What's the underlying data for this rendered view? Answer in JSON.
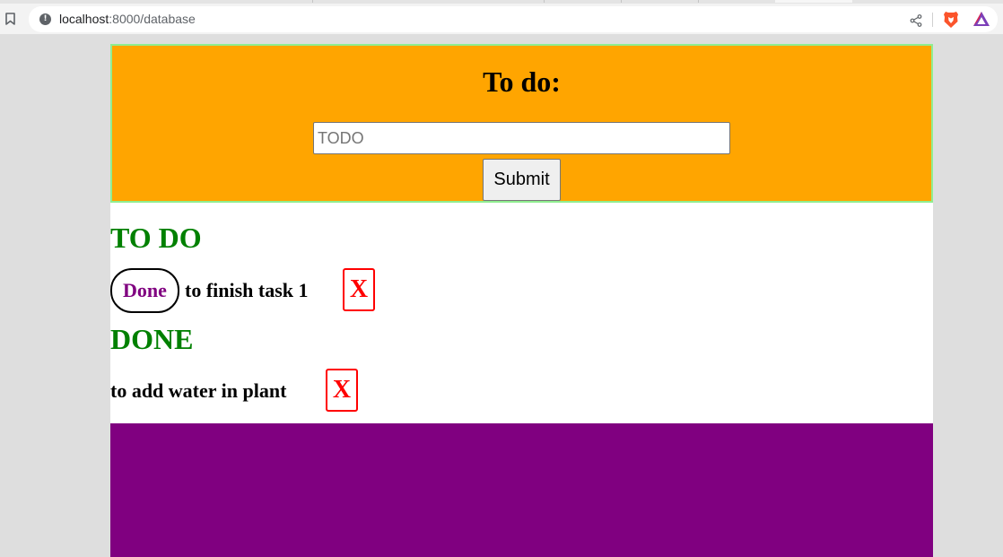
{
  "browser": {
    "url_host": "localhost",
    "url_path": ":8000/database",
    "icons": {
      "bookmark": "bookmark-icon",
      "site_info": "info-icon",
      "share": "share-icon",
      "brave": "brave-shields-icon",
      "rewards": "brave-rewards-icon"
    }
  },
  "form": {
    "title": "To do:",
    "input_placeholder": "TODO",
    "input_value": "",
    "submit_label": "Submit"
  },
  "todo": {
    "heading": "TO DO",
    "items": [
      {
        "done_label": "Done",
        "text": "to finish task 1",
        "delete_label": "X"
      }
    ]
  },
  "done": {
    "heading": "DONE",
    "items": [
      {
        "text": "to add water in plant",
        "delete_label": "X"
      }
    ]
  },
  "colors": {
    "form_background": "#ffa500",
    "form_border": "#90ee90",
    "heading": "#008000",
    "done_button_text": "#800080",
    "delete_button": "#ff0000",
    "footer": "#800080",
    "page_background": "#dedede"
  }
}
